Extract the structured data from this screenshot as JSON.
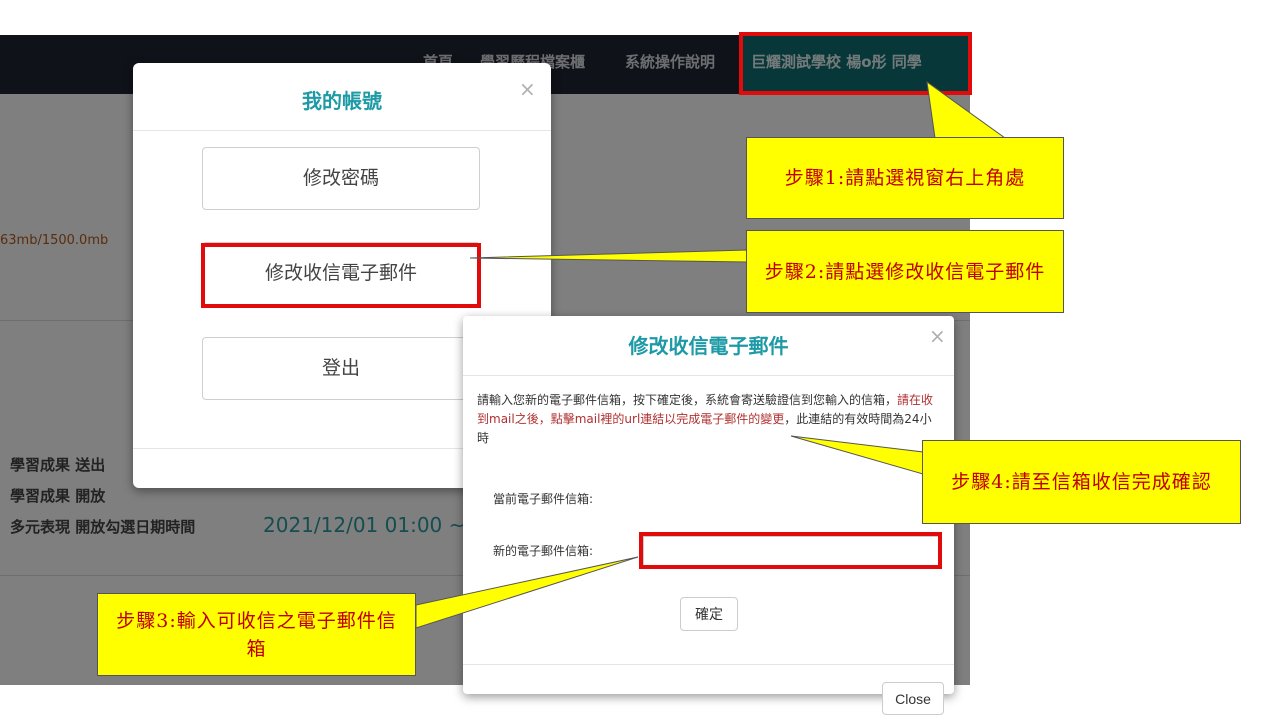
{
  "navbar": {
    "items": [
      "首頁",
      "學習歷程檔案櫃",
      "系統操作說明"
    ],
    "user": "巨耀測試學校 楊o彤 同學"
  },
  "background": {
    "storage": "63mb/1500.0mb",
    "rows": [
      "學習成果 送出",
      "學習成果 開放",
      "多元表現 開放勾選日期時間"
    ],
    "date_value": "2021/12/01 01:00 ~"
  },
  "account_modal": {
    "title": "我的帳號",
    "close": "×",
    "buttons": [
      "修改密碼",
      "修改收信電子郵件",
      "登出"
    ]
  },
  "email_modal": {
    "title": "修改收信電子郵件",
    "close": "×",
    "desc_part1": "請輸入您新的電子郵件信箱，按下確定後，系統會寄送驗證信到您輸入的信箱，",
    "desc_red": "請在收到mail之後，點擊mail裡的url連結以完成電子郵件的變更",
    "desc_part2": "，此連結的有效時間為24小時",
    "current_label": "當前電子郵件信箱:",
    "new_label": "新的電子郵件信箱:",
    "new_value": "",
    "confirm": "確定"
  },
  "close_button": "Close",
  "callouts": {
    "step1": "步驟1:請點選視窗右上角處",
    "step2": "步驟2:請點選修改收信電子郵件",
    "step3": "步驟3:輸入可收信之電子郵件信箱",
    "step4": "步驟4:請至信箱收信完成確認"
  },
  "colors": {
    "accent": "#1d9aa6",
    "highlight": "#e10b0b",
    "callout_bg": "#ffff00",
    "callout_text": "#c00000"
  }
}
